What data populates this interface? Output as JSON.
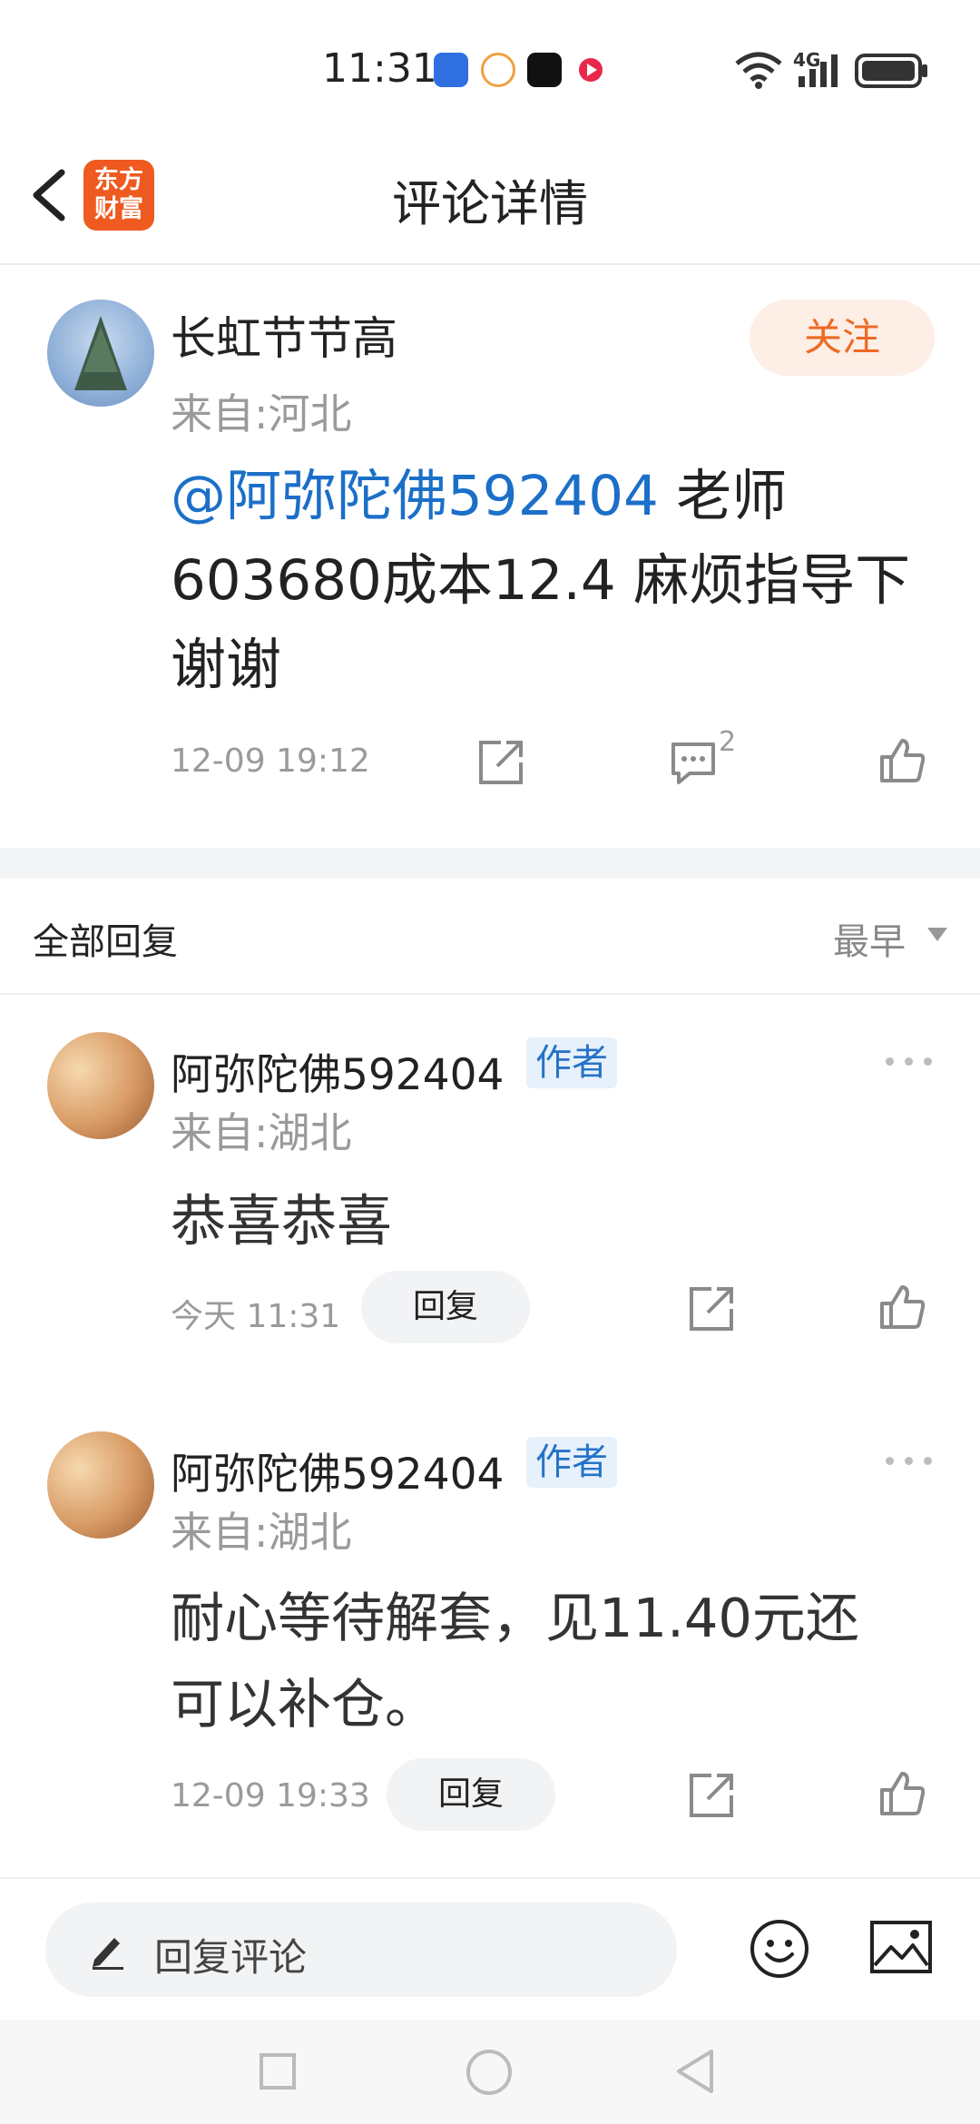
{
  "status_bar": {
    "time": "11:31",
    "network": "4G"
  },
  "header": {
    "title": "评论详情",
    "logo_line1": "东方",
    "logo_line2": "财富"
  },
  "post": {
    "author": "长虹节节高",
    "location": "来自:河北",
    "follow_label": "关注",
    "mention": "@阿弥陀佛592404",
    "text_line1_rest": " 老师",
    "text_line2": "603680成本12.4  麻烦指导下",
    "text_line3": "谢谢",
    "time": "12-09 19:12",
    "comment_count": "2"
  },
  "replies_header": {
    "label": "全部回复",
    "sort": "最早"
  },
  "replies": [
    {
      "author": "阿弥陀佛592404",
      "tag": "作者",
      "location": "来自:湖北",
      "text_line1": "恭喜恭喜",
      "text_line2": "",
      "time": "今天 11:31",
      "reply_label": "回复"
    },
    {
      "author": "阿弥陀佛592404",
      "tag": "作者",
      "location": "来自:湖北",
      "text_line1": "耐心等待解套，见11.40元还",
      "text_line2": "可以补仓。",
      "time": "12-09 19:33",
      "reply_label": "回复"
    }
  ],
  "bottom": {
    "input_placeholder": "回复评论"
  },
  "colors": {
    "brand": "#ee5a1f",
    "link": "#1b6fc8",
    "follow_bg": "#fdeee6"
  }
}
